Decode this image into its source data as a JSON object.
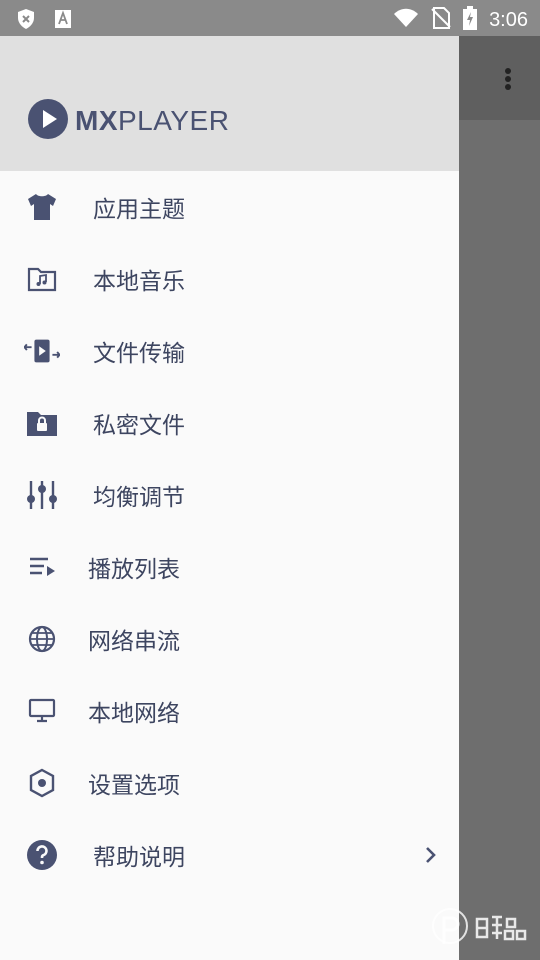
{
  "status_bar": {
    "time": "3:06",
    "icons": [
      "shield-x-icon",
      "font-a-icon",
      "wifi-icon",
      "no-sim-icon",
      "battery-charging-icon"
    ]
  },
  "app": {
    "logo_mx": "MX",
    "logo_player": "PLAYER",
    "toolbar_icon": "overflow-menu-icon"
  },
  "drawer": {
    "items": [
      {
        "label": "应用主题",
        "icon": "tshirt-icon"
      },
      {
        "label": "本地音乐",
        "icon": "music-folder-icon"
      },
      {
        "label": "文件传输",
        "icon": "file-transfer-icon"
      },
      {
        "label": "私密文件",
        "icon": "private-folder-icon"
      },
      {
        "label": "均衡调节",
        "icon": "equalizer-icon"
      },
      {
        "label": "播放列表",
        "icon": "playlist-icon"
      },
      {
        "label": "网络串流",
        "icon": "globe-icon"
      },
      {
        "label": "本地网络",
        "icon": "monitor-icon"
      },
      {
        "label": "设置选项",
        "icon": "settings-icon"
      },
      {
        "label": "帮助说明",
        "icon": "help-icon"
      }
    ]
  },
  "colors": {
    "accent": "#4a5272",
    "drawer_bg": "#fafafa",
    "header_bg": "#e0e0e0"
  }
}
